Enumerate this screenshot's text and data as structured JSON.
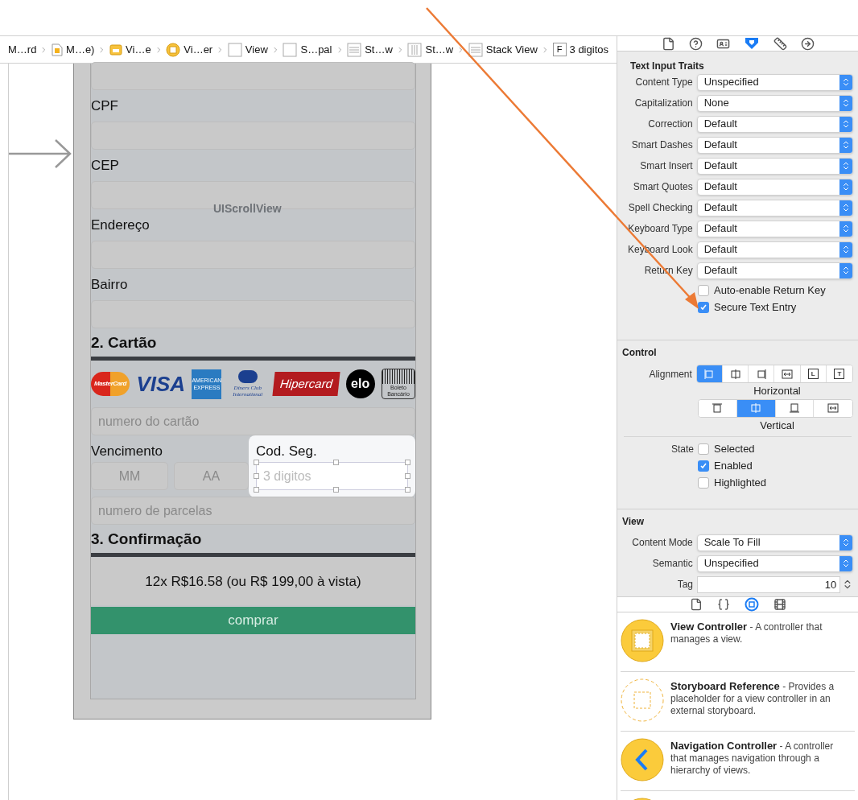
{
  "breadcrumb": [
    {
      "label": "M…rd",
      "kind": "none"
    },
    {
      "label": "M…e)",
      "kind": "storyboard"
    },
    {
      "label": "Vi…e",
      "kind": "scene"
    },
    {
      "label": "Vi…er",
      "kind": "controller"
    },
    {
      "label": "View",
      "kind": "view"
    },
    {
      "label": "S…pal",
      "kind": "view"
    },
    {
      "label": "St…w",
      "kind": "hstack"
    },
    {
      "label": "St…w",
      "kind": "vstack"
    },
    {
      "label": "Stack View",
      "kind": "hstack"
    },
    {
      "label": "3 digitos",
      "kind": "field",
      "glyph": "F"
    }
  ],
  "canvas": {
    "scroll_label": "UIScrollView",
    "fields": [
      {
        "label": "CPF"
      },
      {
        "label": "CEP"
      },
      {
        "label": "Endereço"
      },
      {
        "label": "Bairro"
      }
    ],
    "card_section": "2. Cartão",
    "card_brands": [
      {
        "label": "MasterCard",
        "kind": "mastercard"
      },
      {
        "label": "VISA",
        "kind": "visa"
      },
      {
        "label": "AMERICAN EXPRESS",
        "kind": "amex"
      },
      {
        "label": "Diners Club International",
        "kind": "diners"
      },
      {
        "label": "Hipercard",
        "kind": "hipercard"
      },
      {
        "label": "elo",
        "kind": "elo"
      },
      {
        "label": "Boleto Bancário",
        "kind": "boleto"
      }
    ],
    "card_number": {
      "placeholder": "numero do cartão"
    },
    "expiry": {
      "label": "Vencimento",
      "month": {
        "placeholder": "MM"
      },
      "year": {
        "placeholder": "AA"
      }
    },
    "security": {
      "label": "Cod. Seg.",
      "placeholder": "3 digitos",
      "selected": true
    },
    "installments": {
      "placeholder": "numero de parcelas"
    },
    "confirm_section": "3. Confirmação",
    "price": "12x R$16.58 (ou R$ 199,00 à vista)",
    "buy_button": "comprar"
  },
  "inspector": {
    "tabs": [
      {
        "kind": "file",
        "selected": false
      },
      {
        "kind": "help",
        "selected": false
      },
      {
        "kind": "identity",
        "selected": false
      },
      {
        "kind": "attributes",
        "selected": true
      },
      {
        "kind": "size",
        "selected": false
      },
      {
        "kind": "connections",
        "selected": false
      }
    ],
    "text_input_traits": {
      "title": "Text Input Traits",
      "rows": [
        {
          "label": "Content Type",
          "value": "Unspecified"
        },
        {
          "label": "Capitalization",
          "value": "None"
        },
        {
          "label": "Correction",
          "value": "Default"
        },
        {
          "label": "Smart Dashes",
          "value": "Default"
        },
        {
          "label": "Smart Insert",
          "value": "Default"
        },
        {
          "label": "Smart Quotes",
          "value": "Default"
        },
        {
          "label": "Spell Checking",
          "value": "Default"
        },
        {
          "label": "Keyboard Type",
          "value": "Default"
        },
        {
          "label": "Keyboard Look",
          "value": "Default"
        },
        {
          "label": "Return Key",
          "value": "Default"
        }
      ],
      "checkboxes": [
        {
          "label": "Auto-enable Return Key",
          "checked": false
        },
        {
          "label": "Secure Text Entry",
          "checked": true
        }
      ]
    },
    "control": {
      "title": "Control",
      "alignment_label": "Alignment",
      "horizontal": [
        {
          "kind": "left",
          "selected": true
        },
        {
          "kind": "center",
          "selected": false
        },
        {
          "kind": "right",
          "selected": false
        },
        {
          "kind": "fill",
          "selected": false
        },
        {
          "kind": "leading",
          "selected": false,
          "glyph": "L"
        },
        {
          "kind": "trailing",
          "selected": false,
          "glyph": "T"
        }
      ],
      "horizontal_label": "Horizontal",
      "vertical": [
        {
          "kind": "top",
          "selected": false
        },
        {
          "kind": "center",
          "selected": true
        },
        {
          "kind": "bottom",
          "selected": false
        },
        {
          "kind": "fill",
          "selected": false
        }
      ],
      "vertical_label": "Vertical",
      "state_label": "State",
      "states": [
        {
          "label": "Selected",
          "checked": false
        },
        {
          "label": "Enabled",
          "checked": true
        },
        {
          "label": "Highlighted",
          "checked": false
        }
      ]
    },
    "view": {
      "title": "View",
      "rows": [
        {
          "label": "Content Mode",
          "value": "Scale To Fill"
        },
        {
          "label": "Semantic",
          "value": "Unspecified"
        }
      ],
      "tag_label": "Tag",
      "tag_value": "10"
    }
  },
  "library": {
    "tabs": [
      {
        "kind": "file",
        "selected": false
      },
      {
        "kind": "code",
        "selected": false
      },
      {
        "kind": "object",
        "selected": true
      },
      {
        "kind": "media",
        "selected": false
      }
    ],
    "items": [
      {
        "kind": "view_controller",
        "name": "View Controller",
        "description": " - A controller that manages a view."
      },
      {
        "kind": "storyboard_reference",
        "name": "Storyboard Reference",
        "description": " - Provides a placeholder for a view controller in an external storyboard."
      },
      {
        "kind": "navigation_controller",
        "name": "Navigation Controller",
        "description": " - A controller that manages navigation through a hierarchy of views."
      },
      {
        "kind": "view_controller"
      }
    ]
  }
}
